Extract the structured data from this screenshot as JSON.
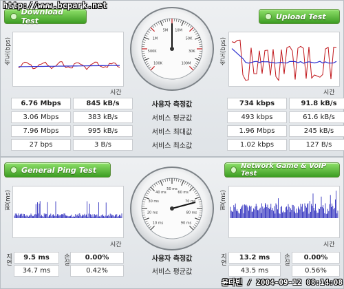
{
  "watermark_url": "http://www.bcpark.net",
  "watermark_footer": "윤다빈 / 2004-09-12 08:14:08",
  "speed_panel": {
    "download_title": "Download Test",
    "upload_title": "Upload Test",
    "y_axis_label": "속도(bps)",
    "x_axis_label": "시간",
    "row_labels": [
      "사용자 측정값",
      "서비스 평균값",
      "서비스 최대값",
      "서비스 최소값"
    ],
    "download_rows": [
      [
        "6.76 Mbps",
        "845 kB/s"
      ],
      [
        "3.06 Mbps",
        "383 kB/s"
      ],
      [
        "7.96 Mbps",
        "995 kB/s"
      ],
      [
        "27 bps",
        "3 B/s"
      ]
    ],
    "upload_rows": [
      [
        "734 kbps",
        "91.8 kB/s"
      ],
      [
        "493 kbps",
        "61.6 kB/s"
      ],
      [
        "1.96 Mbps",
        "245 kB/s"
      ],
      [
        "1.02 kbps",
        "127 B/s"
      ]
    ],
    "gauge_ticks": [
      "100K",
      "500K",
      "1M",
      "5M",
      "10M",
      "50K",
      "30K",
      "100M"
    ]
  },
  "ping_panel": {
    "ping_title": "General Ping Test",
    "game_title": "Network Game & VoIP Test",
    "y_axis_label": "핑(ms)",
    "x_axis_label": "시간",
    "latency_label": "지연",
    "loss_label": "손실",
    "row_labels": [
      "사용자 측정값",
      "서비스 평균값"
    ],
    "ping_rows": [
      [
        "9.5 ms",
        "0.00%"
      ],
      [
        "34.7 ms",
        "0.42%"
      ]
    ],
    "game_rows": [
      [
        "13.2 ms",
        "0.00%"
      ],
      [
        "43.5 ms",
        "0.56%"
      ]
    ],
    "gauge_ticks": [
      "10 ms",
      "20 ms",
      "30 ms",
      "40 ms",
      "50 ms",
      "60 ms",
      "70 ms",
      "80 ms",
      "90 ms"
    ]
  },
  "colors": {
    "download_line": "#c0161b",
    "average_line": "#2a2ecf",
    "ping_bars": "#1a1ab8",
    "pill_green": "#3c9c22"
  }
}
